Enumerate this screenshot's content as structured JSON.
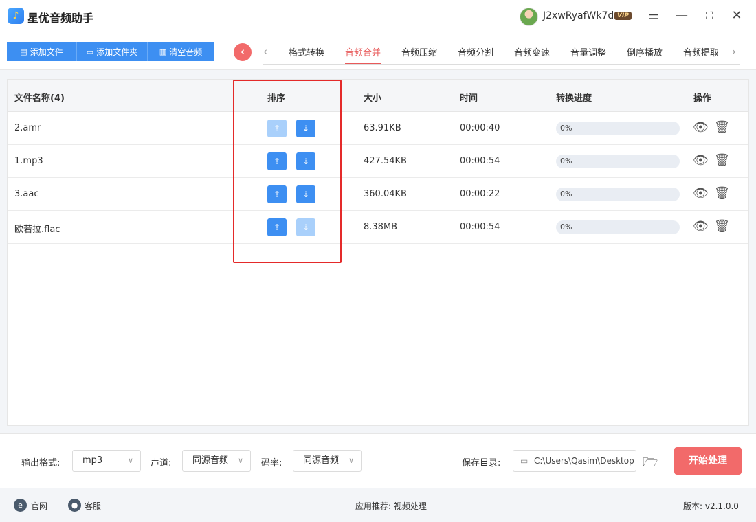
{
  "app": {
    "title": "星优音频助手",
    "logo_glyph": "♪"
  },
  "user": {
    "name": "J2xwRyafWk7d",
    "vip_badge": "VIP"
  },
  "window_controls": {
    "settings": "⚌",
    "minimize": "—",
    "maximize": "⛶",
    "close": "✕"
  },
  "toolbar": {
    "add_file": "添加文件",
    "add_folder": "添加文件夹",
    "clear_audio": "清空音频"
  },
  "tabs": {
    "items": [
      "格式转换",
      "音频合并",
      "音频压缩",
      "音频分割",
      "音频变速",
      "音量调整",
      "倒序播放",
      "音频提取"
    ],
    "active": "音频合并"
  },
  "table": {
    "headers": {
      "name": "文件名称(4)",
      "sort": "排序",
      "size": "大小",
      "time": "时间",
      "progress": "转换进度",
      "actions": "操作"
    },
    "rows": [
      {
        "name": "2.amr",
        "size": "63.91KB",
        "time": "00:00:40",
        "progress": "0%",
        "up_enabled": false,
        "down_enabled": true
      },
      {
        "name": "1.mp3",
        "size": "427.54KB",
        "time": "00:00:54",
        "progress": "0%",
        "up_enabled": true,
        "down_enabled": true
      },
      {
        "name": "3.aac",
        "size": "360.04KB",
        "time": "00:00:22",
        "progress": "0%",
        "up_enabled": true,
        "down_enabled": true
      },
      {
        "name": "欧若拉.flac",
        "size": "8.38MB",
        "time": "00:00:54",
        "progress": "0%",
        "up_enabled": true,
        "down_enabled": false
      }
    ]
  },
  "settings": {
    "format_label": "输出格式:",
    "format_value": "mp3",
    "channel_label": "声道:",
    "channel_value": "同源音频",
    "bitrate_label": "码率:",
    "bitrate_value": "同源音频",
    "save_dir_label": "保存目录:",
    "save_dir_value": "C:\\Users\\Qasim\\Desktop",
    "start_button": "开始处理"
  },
  "footer": {
    "website": "官网",
    "support": "客服",
    "recommend": "应用推荐:  视频处理",
    "version": "版本:  v2.1.0.0"
  },
  "colors": {
    "primary": "#3d8ff2",
    "accent": "#f26a6a",
    "highlight": "#e42a2a"
  }
}
